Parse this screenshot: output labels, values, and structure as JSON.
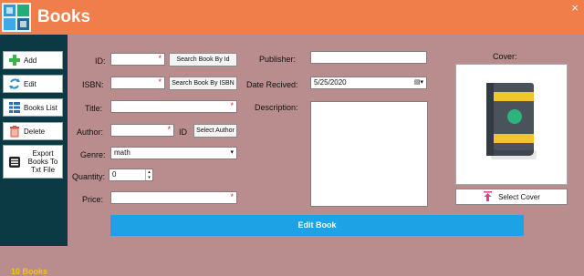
{
  "window": {
    "title": "Books",
    "close_glyph": "×"
  },
  "sidebar": {
    "items": [
      {
        "label": "Add",
        "icon": "plus-icon"
      },
      {
        "label": "Edit",
        "icon": "edit-icon"
      },
      {
        "label": "Books List",
        "icon": "list-icon"
      },
      {
        "label": "Delete",
        "icon": "trash-icon"
      },
      {
        "label": "Export Books To Txt File",
        "icon": "export-icon"
      }
    ],
    "count_label": "10 Books"
  },
  "form": {
    "id_label": "ID:",
    "id_value": "",
    "search_by_id": "Search Book By Id",
    "isbn_label": "ISBN:",
    "isbn_value": "",
    "search_by_isbn": "Search Book By ISBN",
    "title_label": "Title:",
    "title_value": "",
    "author_label": "Author:",
    "author_value": "",
    "author_id_label": "ID",
    "select_author": "Select Author",
    "genre_label": "Genre:",
    "genre_value": "math",
    "quantity_label": "Quantity:",
    "quantity_value": "0",
    "price_label": "Price:",
    "price_value": "",
    "publisher_label": "Publisher:",
    "publisher_value": "",
    "date_label": "Date Recived:",
    "date_value": "5/25/2020",
    "description_label": "Description:",
    "description_value": "",
    "required_mark": "*"
  },
  "cover": {
    "label": "Cover:",
    "select_label": "Select Cover"
  },
  "action": {
    "edit_book": "Edit Book"
  },
  "colors": {
    "titlebar": "#f07e4a",
    "sidebar": "#0b3a44",
    "background": "#b98d8d",
    "primary_button": "#1ea2e6",
    "count_text": "#f2c21a",
    "required": "#e0282c"
  }
}
